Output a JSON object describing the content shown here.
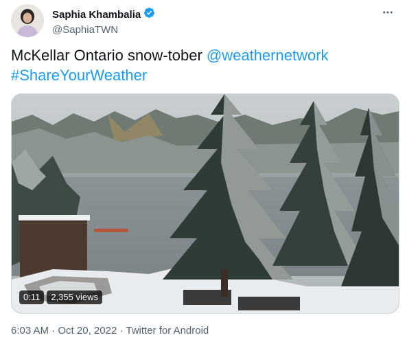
{
  "author": {
    "display_name": "Saphia Khambalia",
    "handle": "@SaphiaTWN",
    "verified_icon": "verified-badge-icon",
    "verified_color": "#1d9bf0"
  },
  "tweet": {
    "text_plain": "McKellar Ontario snow-tober ",
    "mention": "@weathernetwork",
    "hashtag": "#ShareYourWeather",
    "link_color": "#1d9bf0"
  },
  "video": {
    "time": "0:11",
    "views": "2,355 views"
  },
  "meta": {
    "time": "6:03 AM",
    "sep1": "·",
    "date": "Oct 20, 2022",
    "sep2": "·",
    "source": "Twitter for Android"
  },
  "icons": {
    "more": "more-horizontal-icon"
  }
}
